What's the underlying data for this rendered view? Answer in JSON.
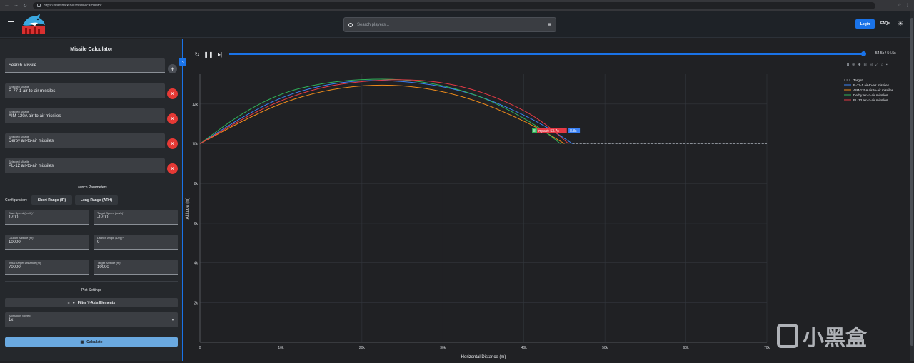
{
  "browser": {
    "url": "https://statshark.net/missilecalculator"
  },
  "header": {
    "search_placeholder": "Search players...",
    "login_label": "Login",
    "faq_label": "FAQs"
  },
  "sidebar": {
    "title": "Missile Calculator",
    "search_missile_label": "Search Missile",
    "selected_label": "Selected Missile",
    "missiles": [
      "R-77-1 air-to-air missiles",
      "AIM-120A air-to-air missiles",
      "Derby air-to-air missiles",
      "PL-12 air-to-air missiles"
    ],
    "launch_title": "Launch Parameters",
    "configuration_label": "Configuration:",
    "config_short": "Short Range (IR)",
    "config_long": "Long Range (ARH)",
    "params": {
      "start_speed_label": "Start Speed (km/h)*",
      "start_speed": "1700",
      "target_speed_label": "Target Speed (km/h)*",
      "target_speed": "-1700",
      "launch_alt_label": "Launch Altitude (m)*",
      "launch_alt": "10000",
      "launch_angle_label": "Launch Angle (Deg)*",
      "launch_angle": "0",
      "init_dist_label": "Initial Target Distance (m)",
      "init_dist": "70000",
      "target_alt_label": "Target Altitude (m)*",
      "target_alt": "10000"
    },
    "plot_title": "Plot Settings",
    "filter_label": "Filter Y-Axis Elements",
    "anim_label": "Animation Speed",
    "anim_value": "1x",
    "calculate_label": "Calculate"
  },
  "player": {
    "time": "54.5s / 54.5s",
    "progress": 1.0
  },
  "colors": {
    "accent": "#1a73e8",
    "danger": "#e53935",
    "calc": "#6aa9e0"
  },
  "chart_data": {
    "type": "line",
    "xlabel": "Horizontal Distance (m)",
    "ylabel": "Altitude (m)",
    "xlim": [
      0,
      70000
    ],
    "ylim": [
      0,
      13500
    ],
    "x_ticks": [
      "0",
      "10k",
      "20k",
      "30k",
      "40k",
      "50k",
      "60k",
      "70k"
    ],
    "y_ticks": [
      "2k",
      "4k",
      "6k",
      "8k",
      "10k",
      "12k"
    ],
    "y_tick_values": [
      2000,
      4000,
      6000,
      8000,
      10000,
      12000
    ],
    "x_tick_values": [
      0,
      10000,
      20000,
      30000,
      40000,
      50000,
      60000,
      70000
    ],
    "grid": true,
    "legend_position": "top-right",
    "series": [
      {
        "name": "Target",
        "color": "#8a8f96",
        "dash": true,
        "x": [
          46000,
          70000
        ],
        "y": [
          10000,
          10000
        ]
      },
      {
        "name": "R-77-1 air-to-air missiles",
        "color": "#3b82f6",
        "x": [
          0,
          5000,
          10000,
          15000,
          20000,
          25000,
          30000,
          35000,
          40000,
          43000,
          46000
        ],
        "y": [
          10000,
          11300,
          12350,
          12950,
          13200,
          13150,
          12900,
          12350,
          11450,
          10800,
          10000
        ]
      },
      {
        "name": "AIM-120A air-to-air missiles",
        "color": "#f08c1a",
        "x": [
          0,
          5000,
          10000,
          15000,
          20000,
          25000,
          30000,
          35000,
          40000,
          43000,
          45000
        ],
        "y": [
          10000,
          11100,
          12050,
          12650,
          12950,
          12950,
          12650,
          12050,
          11150,
          10500,
          10000
        ]
      },
      {
        "name": "Derby air-to-air missiles",
        "color": "#2fb45a",
        "x": [
          0,
          5000,
          10000,
          15000,
          20000,
          25000,
          30000,
          35000,
          40000,
          43000,
          44500
        ],
        "y": [
          10000,
          11500,
          12550,
          13050,
          13250,
          13250,
          12950,
          12350,
          11300,
          10500,
          10000
        ]
      },
      {
        "name": "PL-12 air-to-air missiles",
        "color": "#e53945",
        "x": [
          0,
          5000,
          10000,
          15000,
          20000,
          25000,
          30000,
          35000,
          40000,
          43000,
          45500
        ],
        "y": [
          10000,
          11200,
          12200,
          12850,
          13150,
          13250,
          13100,
          12600,
          11700,
          10900,
          10000
        ]
      }
    ],
    "annotations": [
      {
        "text": "Impact: 53.7s",
        "x": 41500,
        "y": 10650,
        "color": "#e53945"
      },
      {
        "text": "8",
        "x": 41000,
        "y": 10650,
        "color": "#2fb45a"
      },
      {
        "text": "8.8s",
        "x": 45500,
        "y": 10650,
        "color": "#3b82f6"
      }
    ]
  }
}
